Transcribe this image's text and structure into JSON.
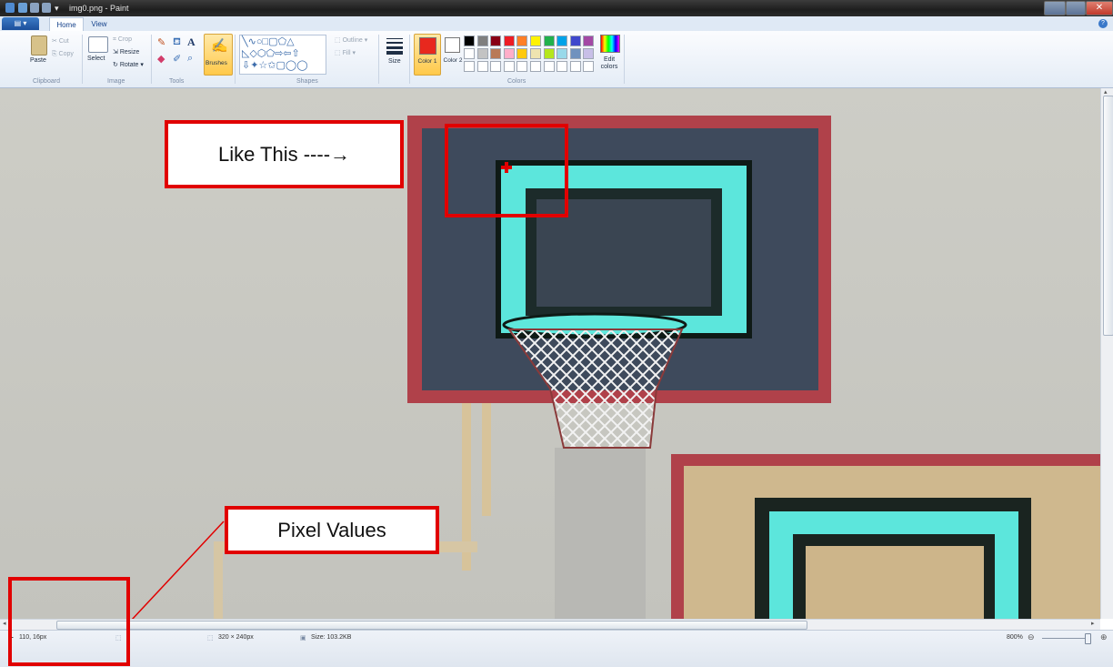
{
  "window": {
    "title": "img0.png - Paint"
  },
  "tabs": {
    "file_label": "",
    "home": "Home",
    "view": "View"
  },
  "ribbon": {
    "clipboard": {
      "paste": "Paste",
      "cut": "Cut",
      "copy": "Copy",
      "group": "Clipboard"
    },
    "image": {
      "select": "Select",
      "crop": "Crop",
      "resize": "Resize",
      "rotate": "Rotate",
      "group": "Image"
    },
    "tools": {
      "group": "Tools",
      "brushes": "Brushes"
    },
    "shapes": {
      "outline": "Outline",
      "fill": "Fill",
      "group": "Shapes"
    },
    "size": {
      "label": "Size"
    },
    "colors": {
      "color1": "Color 1",
      "color2": "Color 2",
      "edit": "Edit colors",
      "group": "Colors",
      "color1_value": "#e8281e",
      "color2_value": "#ffffff",
      "palette_row1": [
        "#000000",
        "#7f7f7f",
        "#880015",
        "#ed1c24",
        "#ff7f27",
        "#fff200",
        "#22b14c",
        "#00a2e8",
        "#3f48cc",
        "#a349a4"
      ],
      "palette_row2": [
        "#ffffff",
        "#c3c3c3",
        "#b97a57",
        "#ffaec9",
        "#ffc90e",
        "#efe4b0",
        "#b5e61d",
        "#99d9ea",
        "#7092be",
        "#c8bfe7"
      ]
    }
  },
  "annotations": {
    "like_this": "Like This ----→",
    "pixel_values": "Pixel Values"
  },
  "status": {
    "cursor": "110, 16px",
    "dimensions": "320 × 240px",
    "size": "Size: 103.2KB",
    "zoom": "800%"
  }
}
